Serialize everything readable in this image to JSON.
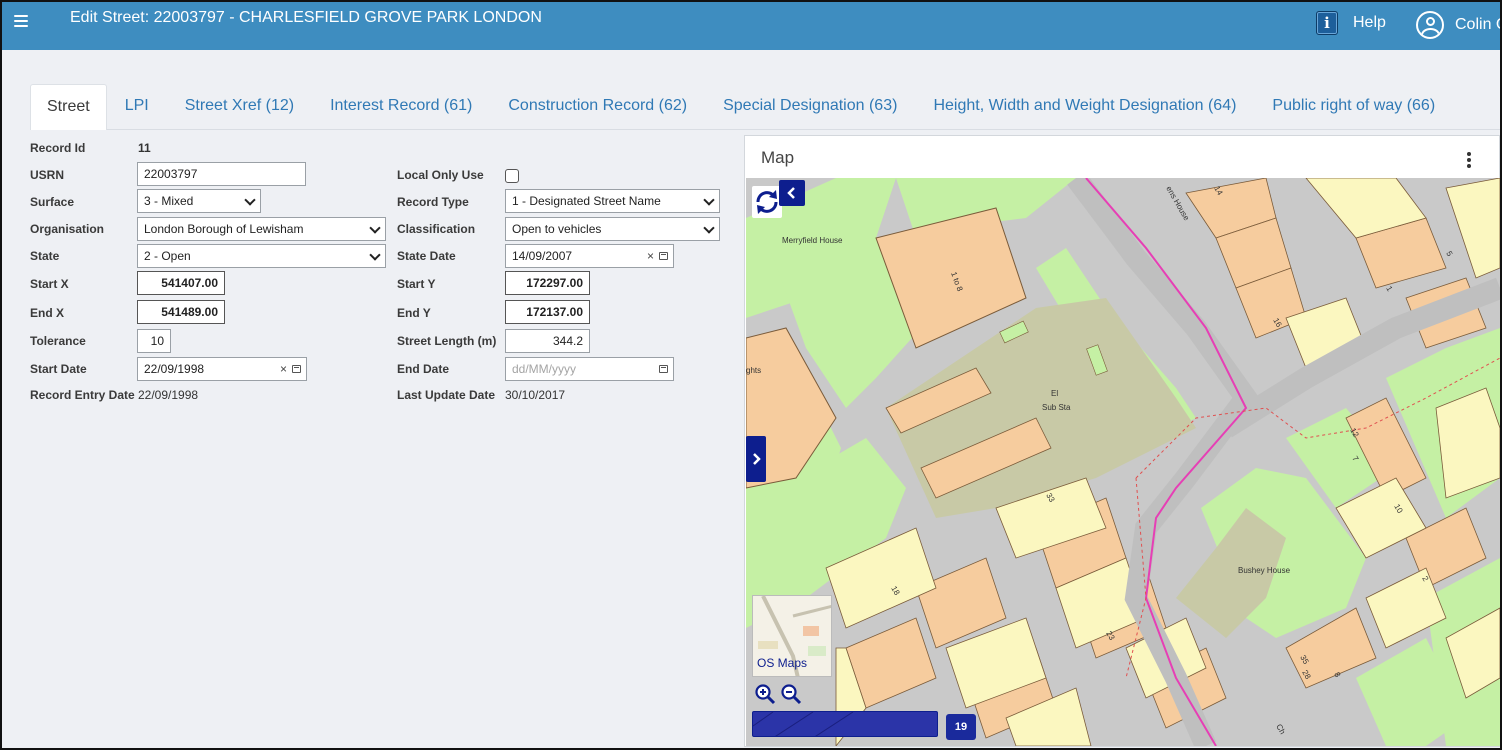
{
  "header": {
    "title": "Edit Street: 22003797 - CHARLESFIELD GROVE PARK LONDON",
    "help_label": "Help",
    "user_label": "Colin C",
    "color": "#3e8dc0"
  },
  "tabs": [
    {
      "label": "Street",
      "active": true
    },
    {
      "label": "LPI"
    },
    {
      "label": "Street Xref (12)"
    },
    {
      "label": "Interest Record (61)"
    },
    {
      "label": "Construction Record (62)"
    },
    {
      "label": "Special Designation (63)"
    },
    {
      "label": "Height, Width and Weight Designation (64)"
    },
    {
      "label": "Public right of way (66)"
    }
  ],
  "form": {
    "record_id": {
      "label": "Record Id",
      "value": "11"
    },
    "usrn": {
      "label": "USRN",
      "value": "22003797"
    },
    "surface": {
      "label": "Surface",
      "value": "3 - Mixed"
    },
    "organisation": {
      "label": "Organisation",
      "value": "London Borough of Lewisham"
    },
    "state": {
      "label": "State",
      "value": "2 - Open"
    },
    "start_x": {
      "label": "Start X",
      "value": "541407.00"
    },
    "end_x": {
      "label": "End X",
      "value": "541489.00"
    },
    "tolerance": {
      "label": "Tolerance",
      "value": "10"
    },
    "start_date": {
      "label": "Start Date",
      "value": "22/09/1998"
    },
    "record_entry_date": {
      "label": "Record Entry Date",
      "value": "22/09/1998"
    },
    "local_only_use": {
      "label": "Local Only Use",
      "checked": false
    },
    "record_type": {
      "label": "Record Type",
      "value": "1 - Designated Street Name"
    },
    "classification": {
      "label": "Classification",
      "value": "Open to vehicles"
    },
    "state_date": {
      "label": "State Date",
      "value": "14/09/2007"
    },
    "start_y": {
      "label": "Start Y",
      "value": "172297.00"
    },
    "end_y": {
      "label": "End Y",
      "value": "172137.00"
    },
    "street_length": {
      "label": "Street Length (m)",
      "value": "344.2"
    },
    "end_date": {
      "label": "End Date",
      "placeholder": "dd/MM/yyyy"
    },
    "last_update_date": {
      "label": "Last Update Date",
      "value": "30/10/2017"
    }
  },
  "map": {
    "title": "Map",
    "labels": {
      "merryfield": "Merryfield House",
      "el": "El",
      "sub_sta": "Sub Sta",
      "bushey": "Bushey House",
      "ghts": "ghts",
      "ens_house": "ens House",
      "n1_8": "1 to 8",
      "n14": "14",
      "n5": "5",
      "n1": "1",
      "n10": "10",
      "n16": "16",
      "n12": "12",
      "n7": "7",
      "n2": "2",
      "n33": "33",
      "n23": "23",
      "n18": "18",
      "n35": "35",
      "n28": "28",
      "n8": "8",
      "ch": "Ch"
    },
    "os_maps_label": "OS Maps",
    "zoom_level": "19",
    "icons": [
      "refresh-icon",
      "chevron-left-icon",
      "chevron-right-icon",
      "zoom-in-icon",
      "zoom-out-icon",
      "kebab-icon"
    ]
  }
}
